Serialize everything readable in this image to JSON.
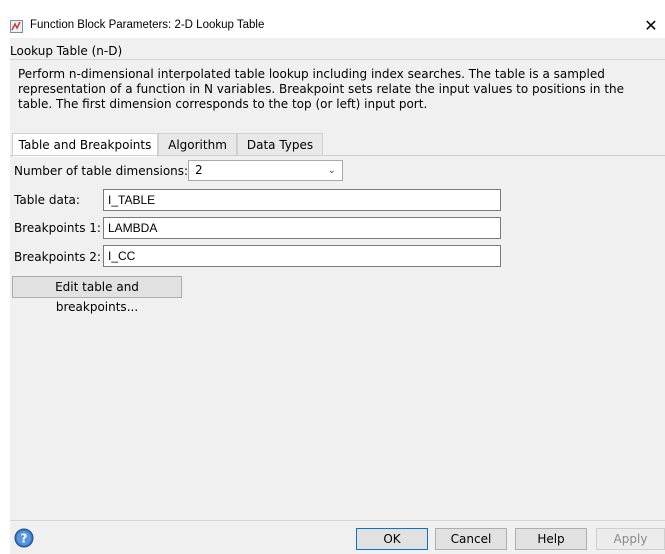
{
  "window": {
    "title": "Function Block Parameters: 2-D Lookup Table",
    "close_glyph": "✕"
  },
  "block": {
    "group_title": "Lookup Table (n-D)",
    "description": "Perform n-dimensional interpolated table lookup including index searches. The table is a sampled representation of a function in N variables. Breakpoint sets relate the input values to positions in the table. The first dimension corresponds to the top (or left) input port."
  },
  "tabs": [
    {
      "label": "Table and Breakpoints",
      "active": true
    },
    {
      "label": "Algorithm",
      "active": false
    },
    {
      "label": "Data Types",
      "active": false
    }
  ],
  "table_breakpoints": {
    "dims_label": "Number of table dimensions:",
    "dims_value": "2",
    "table_data_label": "Table data:",
    "table_data_value": "I_TABLE",
    "bp1_label": "Breakpoints 1:",
    "bp1_value": "LAMBDA",
    "bp2_label": "Breakpoints 2:",
    "bp2_value": "I_CC",
    "edit_button": "Edit table and breakpoints..."
  },
  "buttons": {
    "ok": "OK",
    "cancel": "Cancel",
    "help": "Help",
    "apply": "Apply"
  },
  "icons": {
    "help": "help-circle-icon",
    "app": "simulink-block-icon"
  },
  "colors": {
    "dialog_bg": "#f0f0f0",
    "accent": "#0078d7"
  }
}
